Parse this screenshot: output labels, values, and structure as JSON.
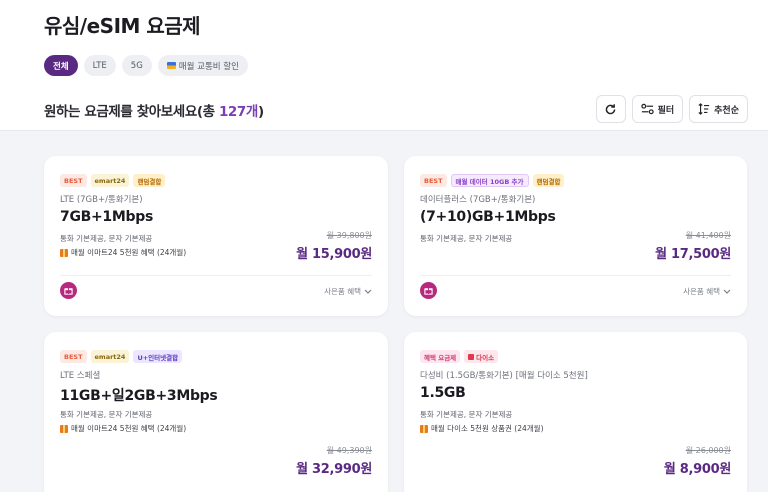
{
  "page": {
    "title": "유심/eSIM 요금제"
  },
  "filters": {
    "chips": [
      {
        "label": "전체",
        "active": true
      },
      {
        "label": "LTE"
      },
      {
        "label": "5G"
      },
      {
        "label": "매월 교통비 할인"
      }
    ]
  },
  "results": {
    "prefix": "원하는 요금제를 찾아보세요(총 ",
    "count": "127개",
    "suffix": ")"
  },
  "tools": {
    "refresh_icon": "refresh-icon",
    "filter_label": "필터",
    "sort_label": "추천순"
  },
  "cards": [
    {
      "tags": [
        "BEST",
        "emart24",
        "랜덤결합"
      ],
      "subtitle": "LTE (7GB+/통화기본)",
      "name": "7GB+1Mbps",
      "desc": "통화 기본제공, 문자 기본제공",
      "benefit": "매월 이마트24 5천원 혜택 (24개월)",
      "original_price": "월 39,800원",
      "price": "월 15,900원",
      "more": "사은품 혜택"
    },
    {
      "tags": [
        "BEST",
        "매월 데이터 10GB 추가",
        "랜덤결합"
      ],
      "subtitle": "데이터플러스 (7GB+/통화기본)",
      "name": "(7+10)GB+1Mbps",
      "desc": "통화 기본제공, 문자 기본제공",
      "original_price": "월 41,400원",
      "price": "월 17,500원",
      "more": "사은품 혜택"
    },
    {
      "tags": [
        "BEST",
        "emart24",
        "U+인터넷결합"
      ],
      "subtitle": "LTE 스페셜",
      "name": "11GB+일2GB+3Mbps",
      "desc": "통화 기본제공, 문자 기본제공",
      "benefit": "매월 이마트24 5천원 혜택 (24개월)",
      "original_price": "월 49,390원",
      "price": "월 32,990원"
    },
    {
      "tags": [
        "혜택 요금제",
        "다이소"
      ],
      "subtitle": "다성비 (1.5GB/통화기본) [매월 다이소 5천원]",
      "name": "1.5GB",
      "desc": "통화 기본제공, 문자 기본제공",
      "benefit": "매월 다이소 5천원 상품권 (24개월)",
      "original_price": "월 26,000원",
      "price": "월 8,900원"
    }
  ]
}
